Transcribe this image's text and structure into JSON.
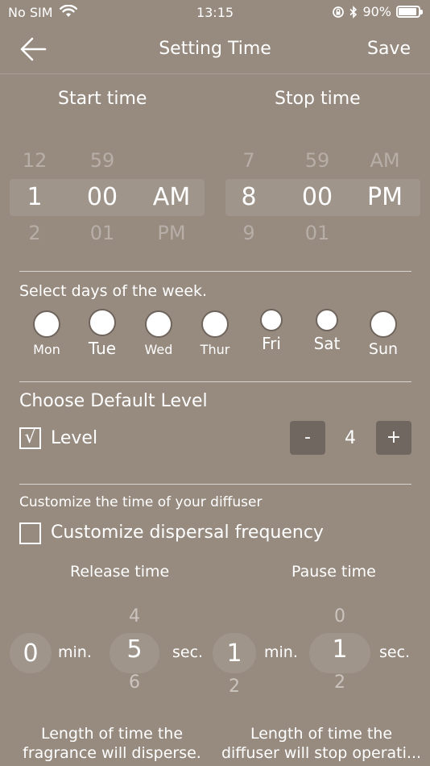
{
  "status_bar": {
    "carrier": "No SIM",
    "time": "13:15",
    "battery": "90%",
    "battery_level": 0.9
  },
  "nav": {
    "title": "Setting Time",
    "save_label": "Save",
    "back_icon": "arrow-left-icon"
  },
  "start_time": {
    "label": "Start time",
    "hour": {
      "prev": "12",
      "selected": "1",
      "next": "2"
    },
    "minute": {
      "prev": "59",
      "selected": "00",
      "next": "01"
    },
    "period": {
      "prev": "",
      "selected": "AM",
      "next": "PM"
    }
  },
  "stop_time": {
    "label": "Stop time",
    "hour": {
      "prev": "7",
      "selected": "8",
      "next": "9"
    },
    "minute": {
      "prev": "59",
      "selected": "00",
      "next": "01"
    },
    "period": {
      "prev": "AM",
      "selected": "PM",
      "next": ""
    }
  },
  "days": {
    "title": "Select days of the week.",
    "items": [
      {
        "label": "Mon"
      },
      {
        "label": "Tue"
      },
      {
        "label": "Wed"
      },
      {
        "label": "Thur"
      },
      {
        "label": "Fri"
      },
      {
        "label": "Sat"
      },
      {
        "label": "Sun"
      }
    ]
  },
  "level": {
    "title": "Choose Default Level",
    "check_mark": "√",
    "label": "Level",
    "minus": "-",
    "value": "4",
    "plus": "+"
  },
  "customize": {
    "hint": "Customize the time of your diffuser",
    "checkbox_label": "Customize dispersal frequency",
    "release": {
      "label": "Release time",
      "min_value": "0",
      "min_unit": "min.",
      "sec_prev": "4",
      "sec_value": "5",
      "sec_next": "6",
      "sec_unit": "sec.",
      "description_line1": "Length of time the",
      "description_line2": "fragrance will disperse."
    },
    "pause": {
      "label": "Pause time",
      "min_value": "1",
      "min_next": "2",
      "min_unit": "min.",
      "sec_prev": "0",
      "sec_value": "1",
      "sec_next": "2",
      "sec_unit": "sec.",
      "description_line1": "Length of time the",
      "description_line2": "diffuser will stop operati..."
    }
  }
}
